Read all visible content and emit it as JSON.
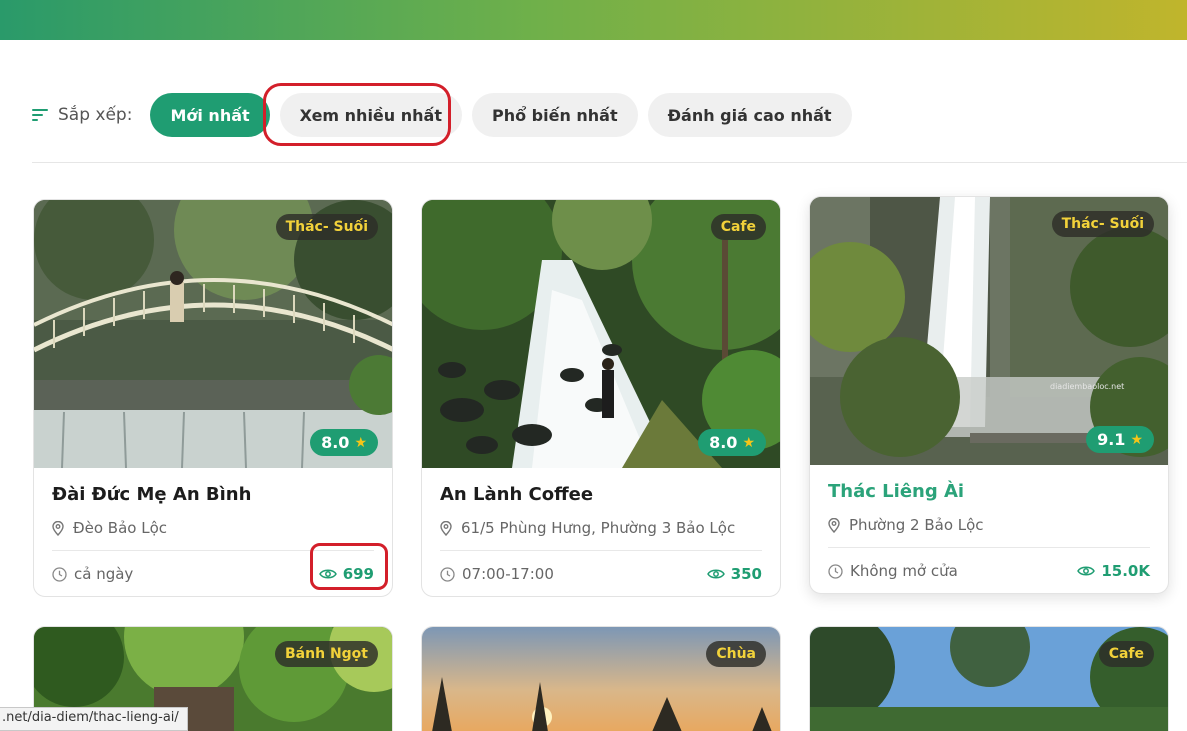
{
  "sort": {
    "label": "Sắp xếp:",
    "options": [
      "Mới nhất",
      "Xem nhiều nhất",
      "Phổ biến nhất",
      "Đánh giá cao nhất"
    ],
    "active_index": 0
  },
  "cards": [
    {
      "tag": "Thác- Suối",
      "rating": "8.0",
      "title": "Đài Đức Mẹ An Bình",
      "location": "Đèo Bảo Lộc",
      "hours": "cả ngày",
      "views": "699"
    },
    {
      "tag": "Cafe",
      "rating": "8.0",
      "title": "An Lành Coffee",
      "location": "61/5 Phùng Hưng, Phường 3 Bảo Lộc",
      "hours": "07:00-17:00",
      "views": "350"
    },
    {
      "tag": "Thác- Suối",
      "rating": "9.1",
      "title": "Thác Liêng Ài",
      "location": "Phường 2 Bảo Lộc",
      "hours": "Không mở cửa",
      "views": "15.0K",
      "watermark": "diadiembaoloc.net"
    },
    {
      "tag": "Bánh Ngọt"
    },
    {
      "tag": "Chùa"
    },
    {
      "tag": "Cafe"
    }
  ],
  "status_url": ".net/dia-diem/thac-lieng-ai/",
  "colors": {
    "accent": "#1f9d72",
    "annotation": "#d31f2a",
    "tag_text": "#f2d23a"
  }
}
